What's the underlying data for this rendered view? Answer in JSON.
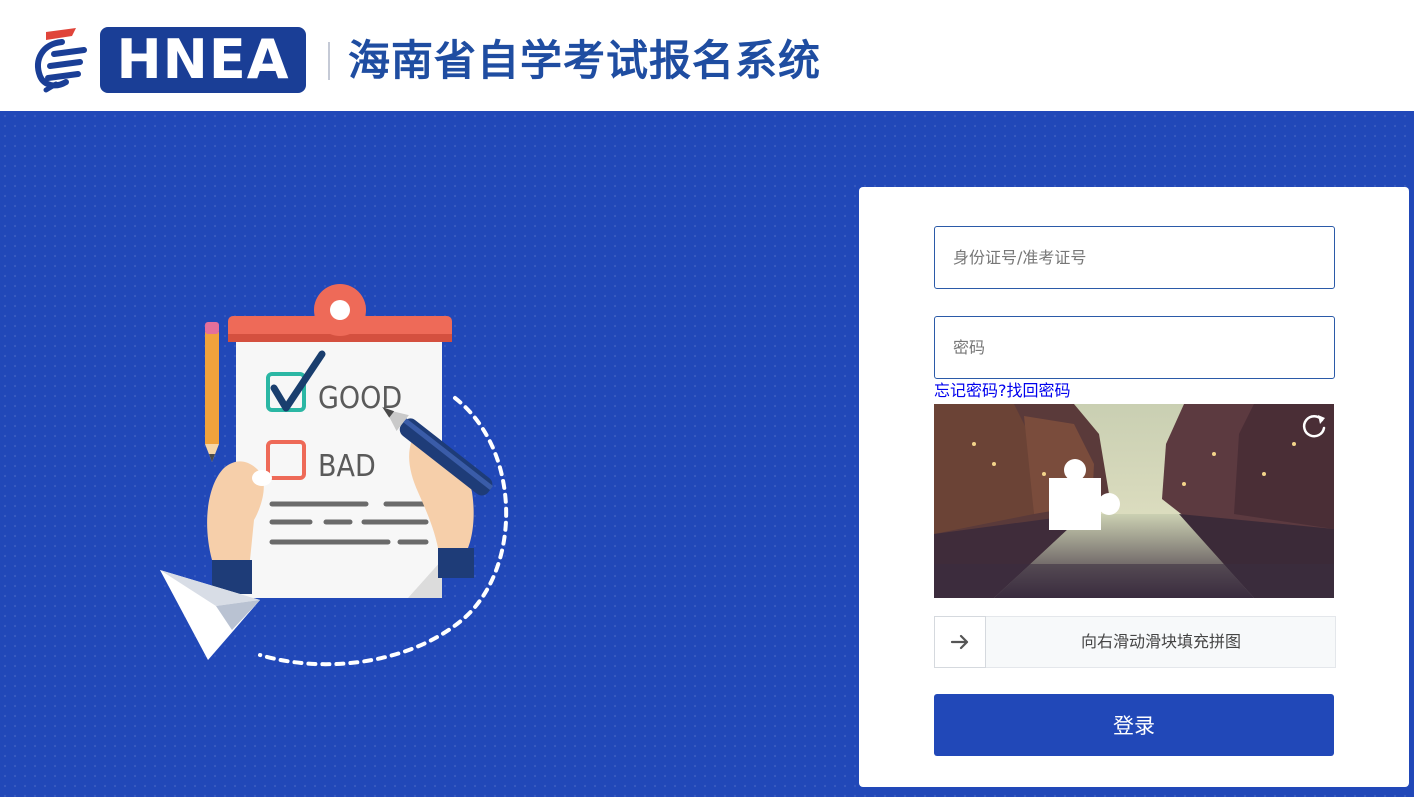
{
  "header": {
    "logo_text": "HNEA",
    "site_title": "海南省自学考试报名系统"
  },
  "login": {
    "id_placeholder": "身份证号/准考证号",
    "password_placeholder": "密码",
    "forgot_link": "忘记密码?找回密码",
    "slider_hint": "向右滑动滑块填充拼图",
    "submit_label": "登录"
  },
  "illustration": {
    "good_label": "GOOD",
    "bad_label": "BAD"
  },
  "colors": {
    "brand_blue": "#2148b8",
    "logo_blue": "#1a3e96",
    "title_blue": "#1f4da1",
    "link_blue": "#0000ee"
  },
  "icons": {
    "refresh": "refresh-icon",
    "slider_arrow": "arrow-right-icon"
  }
}
